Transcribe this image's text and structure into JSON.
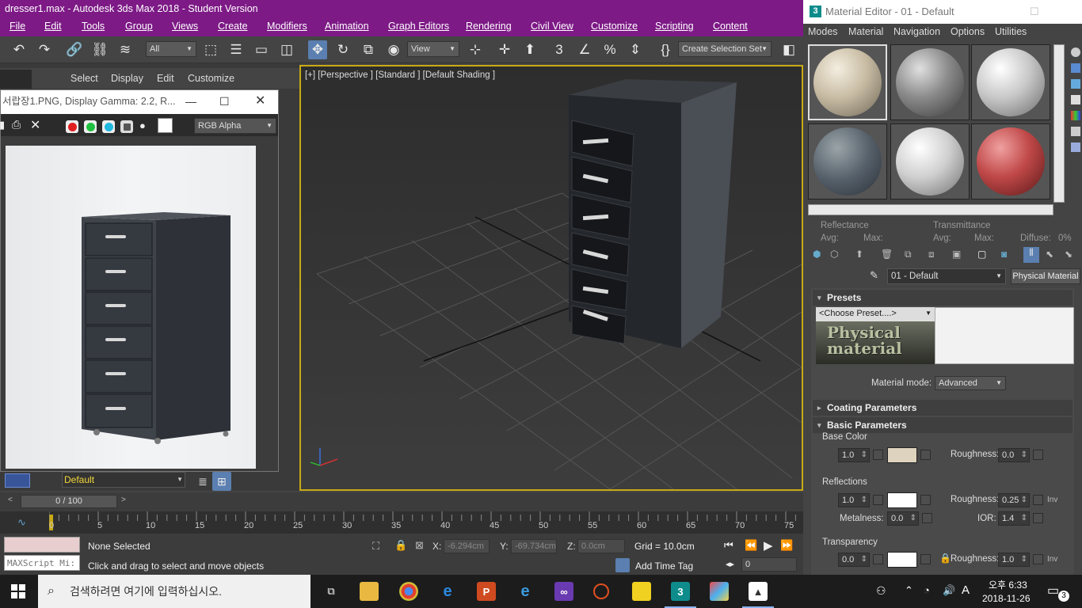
{
  "app": {
    "window_title": "dresser1.max - Autodesk 3ds Max 2018 - Student Version",
    "menu": [
      "File",
      "Edit",
      "Tools",
      "Group",
      "Views",
      "Create",
      "Modifiers",
      "Animation",
      "Graph Editors",
      "Rendering",
      "Civil View",
      "Customize",
      "Scripting",
      "Content"
    ]
  },
  "toolbar": {
    "filter_value": "All",
    "ref_coord_value": "View",
    "selection_set_value": "Create Selection Set"
  },
  "command_panel": {
    "tabs": [
      "Select",
      "Display",
      "Edit",
      "Customize"
    ]
  },
  "frame_buffer": {
    "title": "서랍장1.PNG, Display Gamma: 2.2, R...",
    "channel_value": "RGB Alpha"
  },
  "viewport": {
    "label": "[+] [Perspective ] [Standard ] [Default Shading ]"
  },
  "layer": {
    "current": "Default"
  },
  "timeline": {
    "frame_readout": "0 / 100",
    "ticks": [
      "0",
      "5",
      "10",
      "15",
      "20",
      "25",
      "30",
      "35",
      "40",
      "45",
      "50",
      "55",
      "60",
      "65",
      "70",
      "75"
    ]
  },
  "status": {
    "selection": "None Selected",
    "prompt": "Click and drag to select and move objects",
    "maxscript_placeholder": "MAXScript Mi:",
    "x_label": "X:",
    "x_value": "-6.294cm",
    "y_label": "Y:",
    "y_value": "-69.734cm",
    "z_label": "Z:",
    "z_value": "0.0cm",
    "grid": "Grid = 10.0cm",
    "add_time_tag": "Add Time Tag",
    "frame_field": "0"
  },
  "material_editor": {
    "title": "Material Editor - 01 - Default",
    "menu": [
      "Modes",
      "Material",
      "Navigation",
      "Options",
      "Utilities"
    ],
    "reflectance_label": "Reflectance",
    "transmittance_label": "Transmittance",
    "avg_label": "Avg:",
    "max_label": "Max:",
    "diffuse_label": "Diffuse:",
    "diffuse_value": "0%",
    "material_name": "01 - Default",
    "material_type": "Physical Material",
    "presets_header": "Presets",
    "choose_preset": "<Choose Preset....>",
    "logo_text": "Physical material",
    "material_mode_label": "Material mode:",
    "material_mode_value": "Advanced",
    "coating_header": "Coating Parameters",
    "basic_header": "Basic Parameters",
    "base_color_label": "Base Color",
    "base_weight": "1.0",
    "roughness_label": "Roughness:",
    "base_roughness": "0.0",
    "reflections_label": "Reflections",
    "refl_weight": "1.0",
    "refl_roughness": "0.25",
    "inv_label": "Inv",
    "metalness_label": "Metalness:",
    "metalness_value": "0.0",
    "ior_label": "IOR:",
    "ior_value": "1.4",
    "transparency_label": "Transparency",
    "transp_weight": "0.0",
    "transp_roughness": "1.0",
    "base_color": "#ded3bf"
  },
  "taskbar": {
    "search_placeholder": "검색하려면 여기에 입력하십시오.",
    "time": "오후 6:33",
    "date": "2018-11-26",
    "notification_count": "3",
    "ime": "A"
  }
}
